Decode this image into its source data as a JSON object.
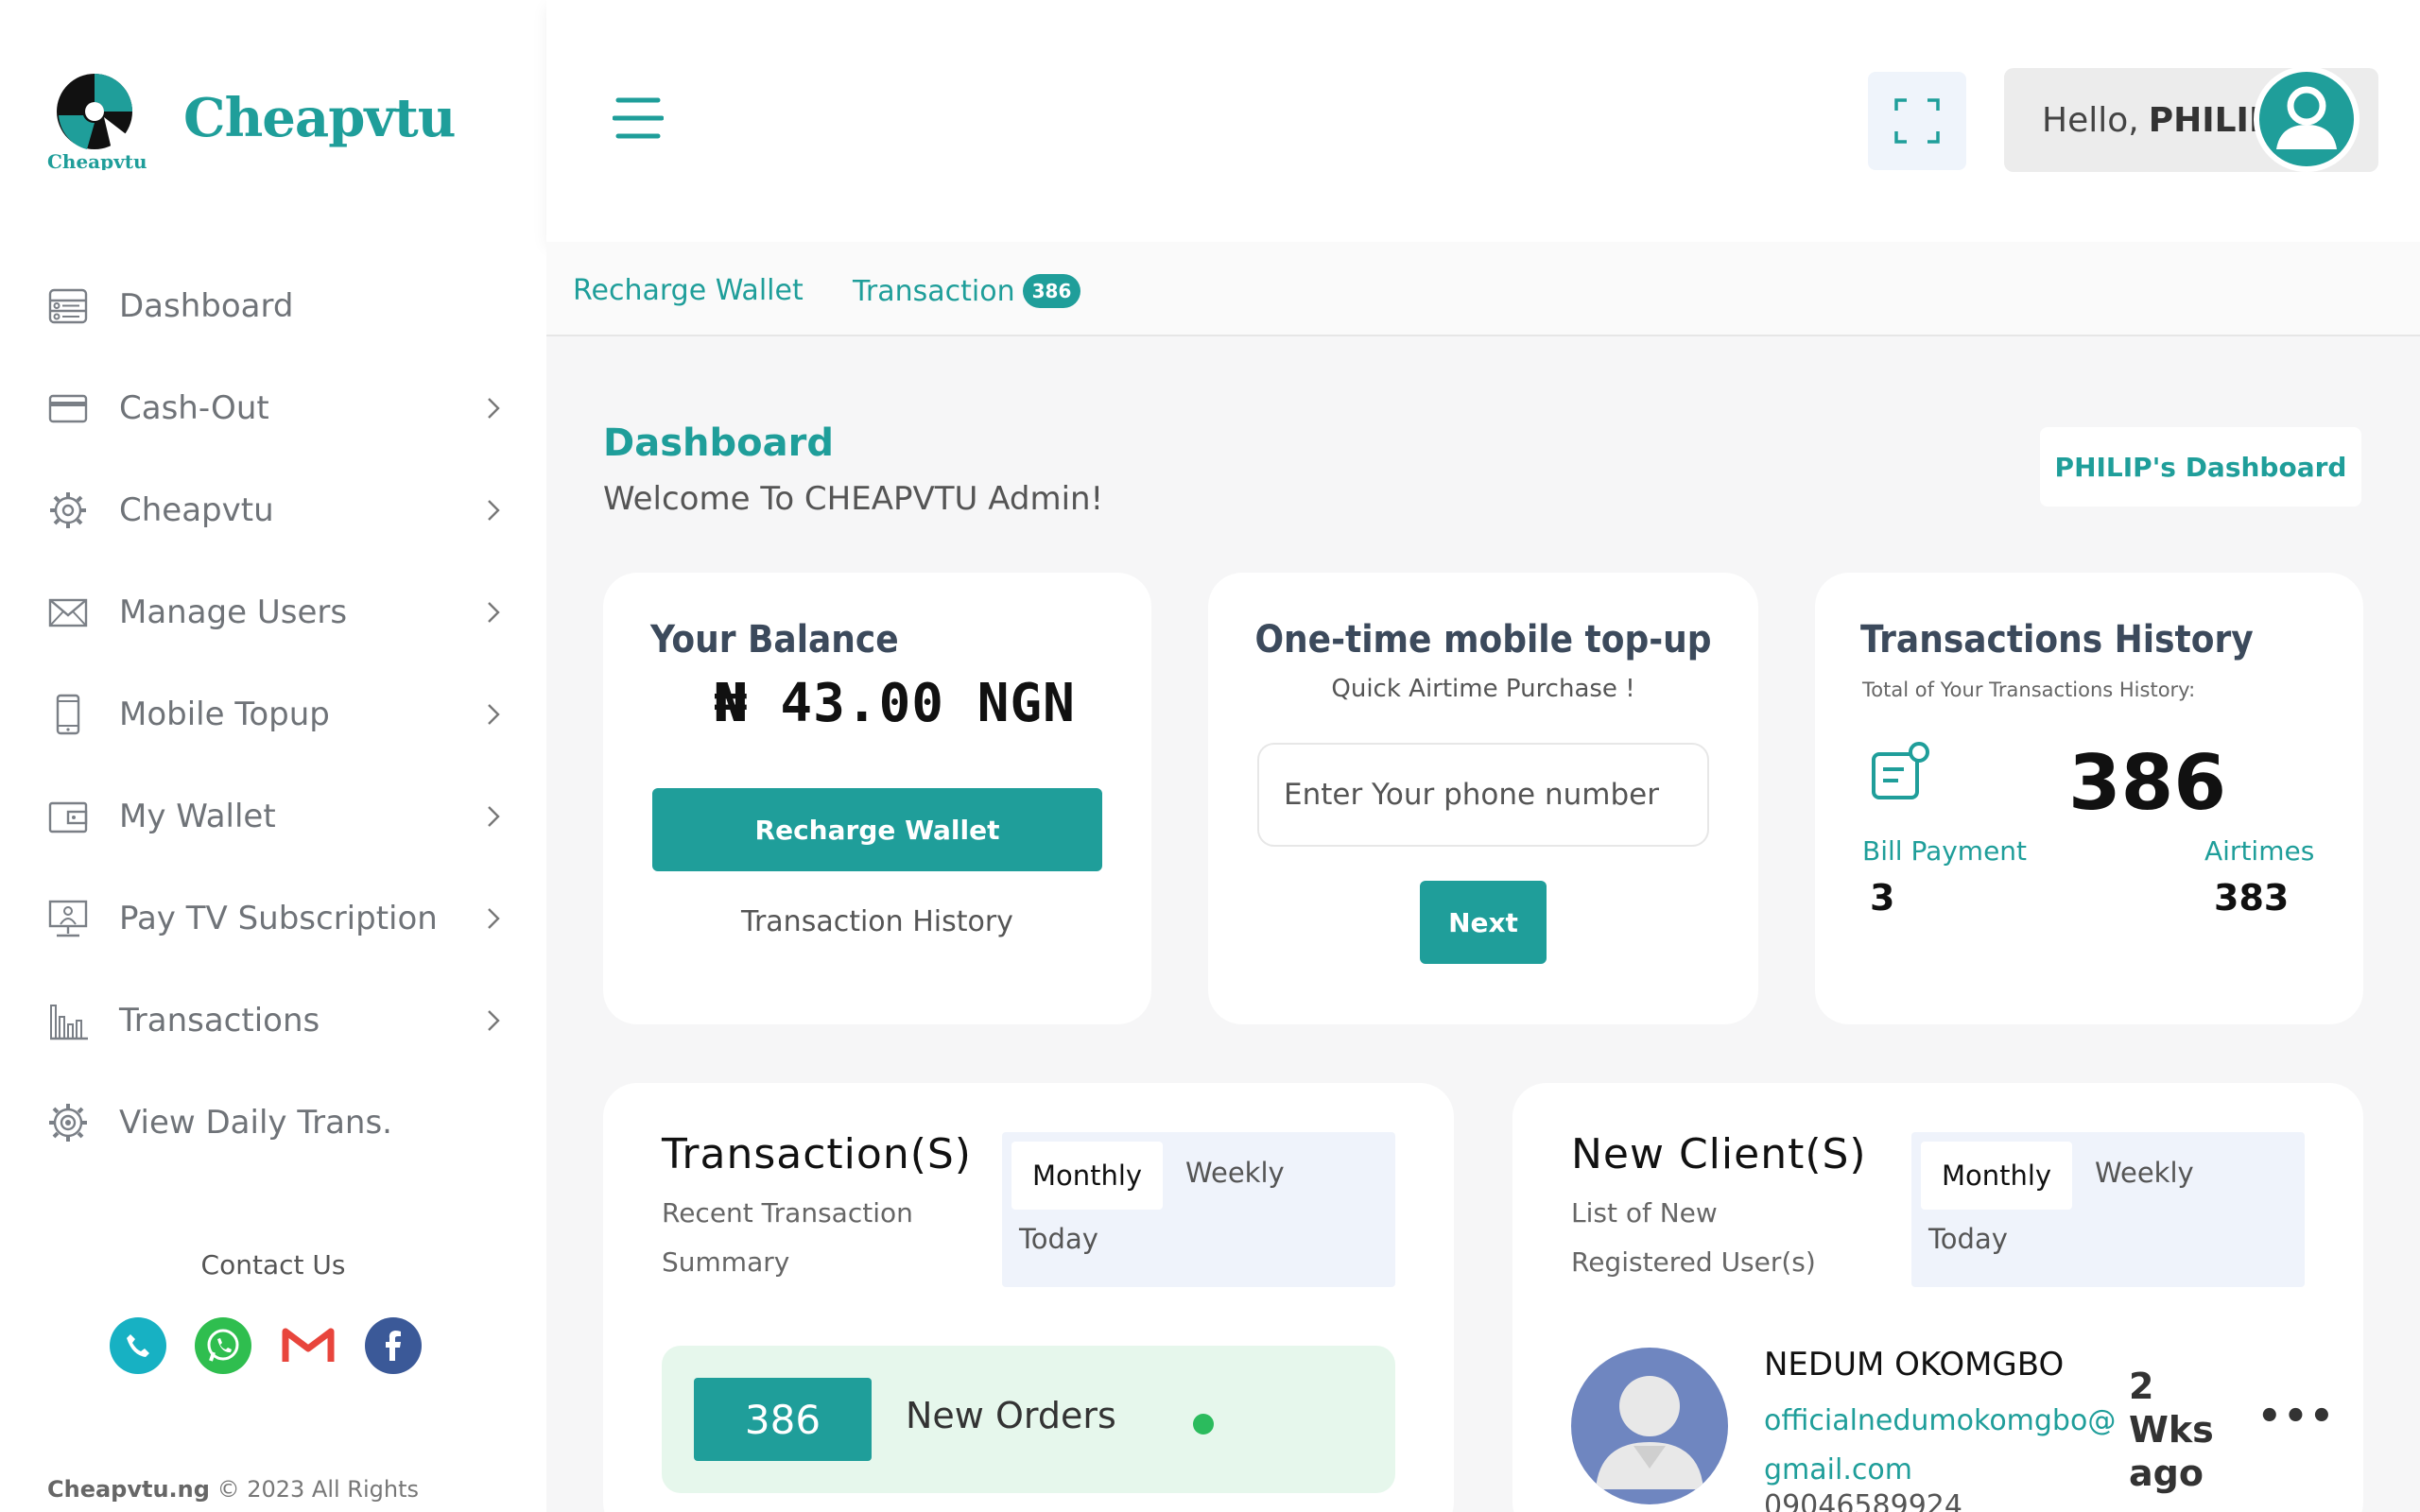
{
  "brand": {
    "name": "Cheapvtu",
    "logo_caption": "Cheapvtu"
  },
  "sidebar": {
    "items": [
      {
        "label": "Dashboard",
        "icon": "dashboard-icon",
        "chevron": false
      },
      {
        "label": "Cash-Out",
        "icon": "card-icon",
        "chevron": true
      },
      {
        "label": "Cheapvtu",
        "icon": "gear-icon",
        "chevron": true
      },
      {
        "label": "Manage Users",
        "icon": "mail-icon",
        "chevron": true
      },
      {
        "label": "Mobile Topup",
        "icon": "phone-icon",
        "chevron": true
      },
      {
        "label": "My Wallet",
        "icon": "wallet-icon",
        "chevron": true
      },
      {
        "label": "Pay TV Subscription",
        "icon": "tv-icon",
        "chevron": true
      },
      {
        "label": "Transactions",
        "icon": "bar-chart-icon",
        "chevron": true
      },
      {
        "label": "View Daily Trans.",
        "icon": "settings-icon",
        "chevron": false
      }
    ],
    "contact_label": "Contact Us",
    "copyright_brand": "Cheapvtu.ng",
    "copyright_text": "© 2023 All Rights"
  },
  "topbar": {
    "greeting": "Hello,",
    "user": "PHILIP"
  },
  "subnav": {
    "recharge": "Recharge Wallet",
    "transaction": "Transaction",
    "transaction_badge": "386"
  },
  "page": {
    "title": "Dashboard",
    "subtitle": "Welcome To CHEAPVTU Admin!",
    "dashboard_button": "PHILIP's Dashboard"
  },
  "balance_card": {
    "title": "Your Balance",
    "value": "₦ 43.00 NGN",
    "button": "Recharge Wallet",
    "link": "Transaction History"
  },
  "topup_card": {
    "title": "One-time mobile top-up",
    "subtitle": "Quick Airtime Purchase !",
    "placeholder": "Enter Your phone number",
    "button": "Next"
  },
  "history_card": {
    "title": "Transactions History",
    "subtitle": "Total of Your Transactions History:",
    "total": "386",
    "bill_label": "Bill Payment",
    "bill_value": "3",
    "airtime_label": "Airtimes",
    "airtime_value": "383"
  },
  "transactions_panel": {
    "title": "Transaction(S)",
    "subtitle": "Recent Transaction Summary",
    "tabs": [
      "Monthly",
      "Weekly",
      "Today"
    ],
    "orders_count": "386",
    "orders_label": "New Orders"
  },
  "clients_panel": {
    "title": "New Client(S)",
    "subtitle": "List of New Registered User(s)",
    "tabs": [
      "Monthly",
      "Weekly",
      "Today"
    ],
    "client": {
      "name": "NEDUM OKOMGBO",
      "email": "officialnedumokomgbo@gmail.com",
      "phone": "09046589924",
      "time": "2 Wks ago",
      "more": "•••"
    }
  },
  "colors": {
    "accent": "#1f9e9a",
    "text_dark": "#3c4a5c",
    "green_dot": "#2bbb5d"
  }
}
